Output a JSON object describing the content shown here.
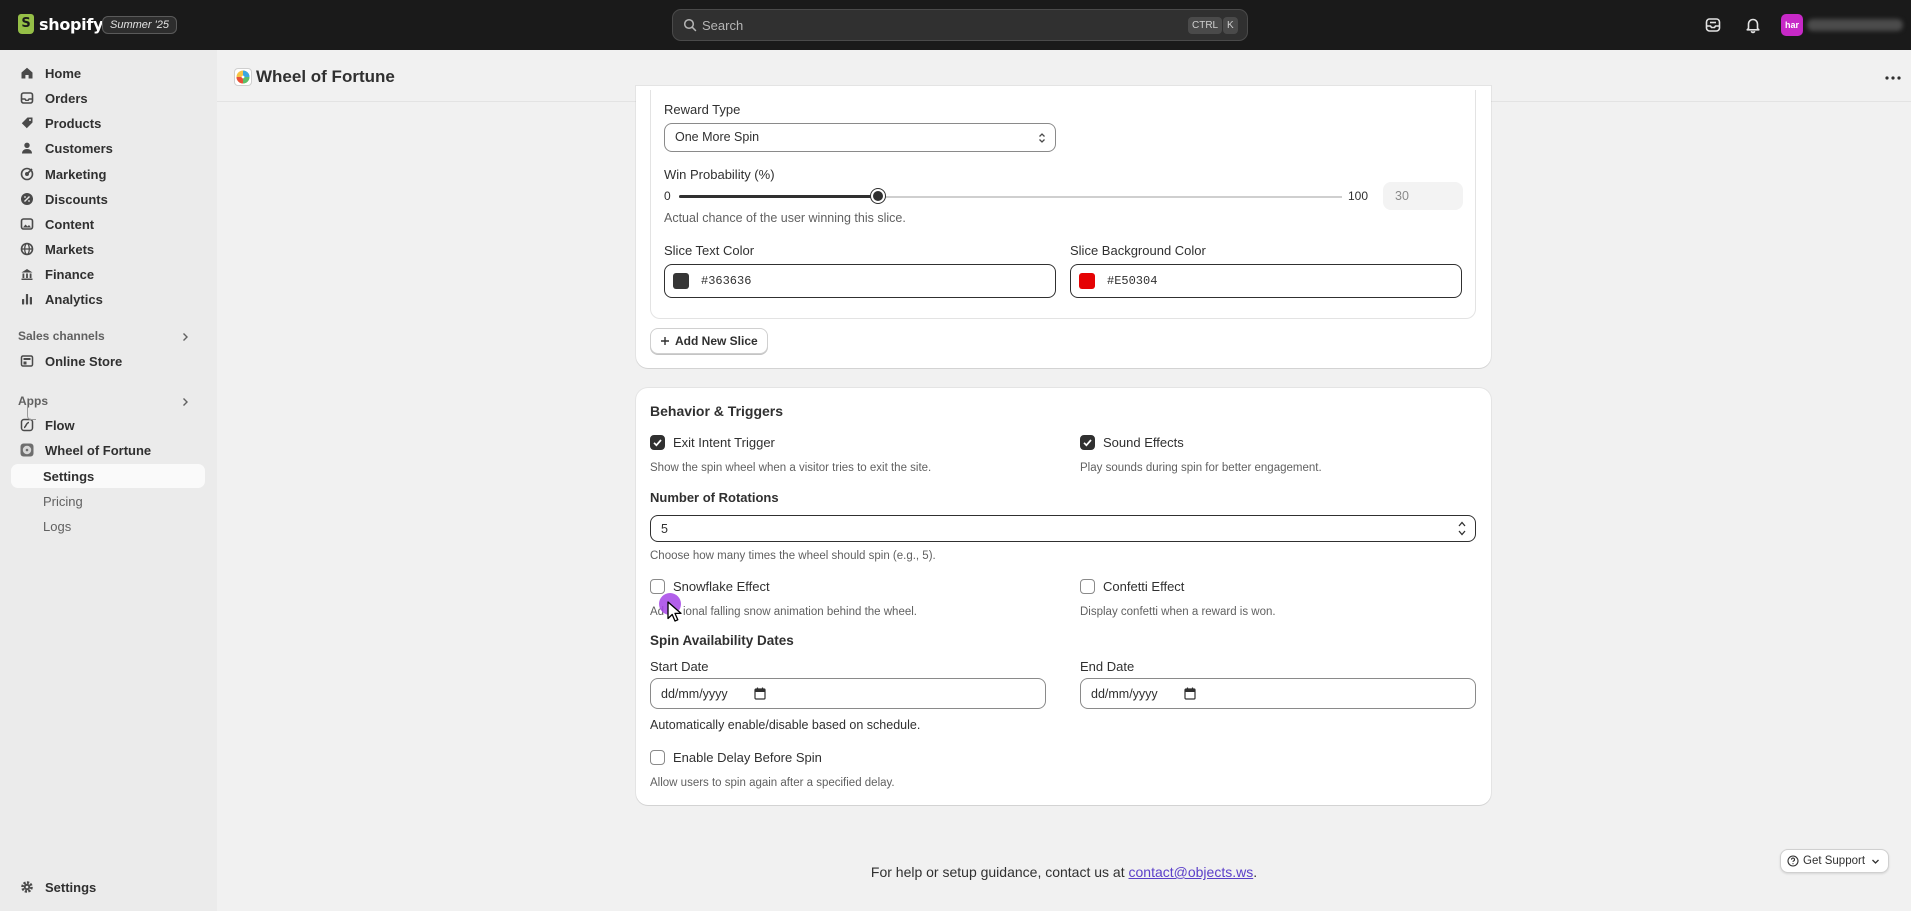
{
  "topbar": {
    "logo_text": "shopify",
    "logo_glyph": "S",
    "edition_badge": "Summer '25",
    "search_placeholder": "Search",
    "shortcut_ctrl": "CTRL",
    "shortcut_key": "K",
    "avatar_initials": "har"
  },
  "sidebar": {
    "items": [
      {
        "label": "Home",
        "icon": "home-icon"
      },
      {
        "label": "Orders",
        "icon": "orders-icon"
      },
      {
        "label": "Products",
        "icon": "products-icon"
      },
      {
        "label": "Customers",
        "icon": "customers-icon"
      },
      {
        "label": "Marketing",
        "icon": "marketing-icon"
      },
      {
        "label": "Discounts",
        "icon": "discounts-icon"
      },
      {
        "label": "Content",
        "icon": "content-icon"
      },
      {
        "label": "Markets",
        "icon": "markets-icon"
      },
      {
        "label": "Finance",
        "icon": "finance-icon"
      },
      {
        "label": "Analytics",
        "icon": "analytics-icon"
      }
    ],
    "sales_channels_label": "Sales channels",
    "online_store": "Online Store",
    "apps_label": "Apps",
    "flow": "Flow",
    "wheel_app": "Wheel of Fortune",
    "sub_items": [
      "Settings",
      "Pricing",
      "Logs"
    ],
    "footer_settings": "Settings"
  },
  "page": {
    "title": "Wheel of Fortune"
  },
  "slice_card": {
    "reward_type_label": "Reward Type",
    "reward_type_value": "One More Spin",
    "win_prob_label": "Win Probability (%)",
    "slider_min": "0",
    "slider_max": "100",
    "slider_value": "30",
    "win_prob_help": "Actual chance of the user winning this slice.",
    "text_color_label": "Slice Text Color",
    "text_color_value": "#363636",
    "bg_color_label": "Slice Background Color",
    "bg_color_value": "#E50304",
    "add_slice_button": "Add New Slice"
  },
  "behavior": {
    "heading": "Behavior & Triggers",
    "exit_intent_label": "Exit Intent Trigger",
    "exit_intent_checked": true,
    "exit_intent_help": "Show the spin wheel when a visitor tries to exit the site.",
    "sound_label": "Sound Effects",
    "sound_checked": true,
    "sound_help": "Play sounds during spin for better engagement.",
    "rotations_label": "Number of Rotations",
    "rotations_value": "5",
    "rotations_help": "Choose how many times the wheel should spin (e.g., 5).",
    "snowflake_label": "Snowflake Effect",
    "snowflake_checked": false,
    "snowflake_help_left": "Ad",
    "snowflake_help_right": "ional falling snow animation behind the wheel.",
    "confetti_label": "Confetti Effect",
    "confetti_checked": false,
    "confetti_help": "Display confetti when a reward is won.",
    "dates_heading": "Spin Availability Dates",
    "start_label": "Start Date",
    "start_placeholder": "dd/mm/yyyy",
    "end_label": "End Date",
    "end_placeholder": "dd/mm/yyyy",
    "schedule_help": "Automatically enable/disable based on schedule.",
    "delay_label": "Enable Delay Before Spin",
    "delay_checked": false,
    "delay_help": "Allow users to spin again after a specified delay."
  },
  "footer": {
    "help_text": "For help or setup guidance, contact us at ",
    "email": "contact@objects.ws",
    "period": ".",
    "support_button": "Get Support"
  },
  "colors": {
    "text_swatch": "#363636",
    "bg_swatch": "#E50304",
    "cursor": "#a444e6"
  }
}
